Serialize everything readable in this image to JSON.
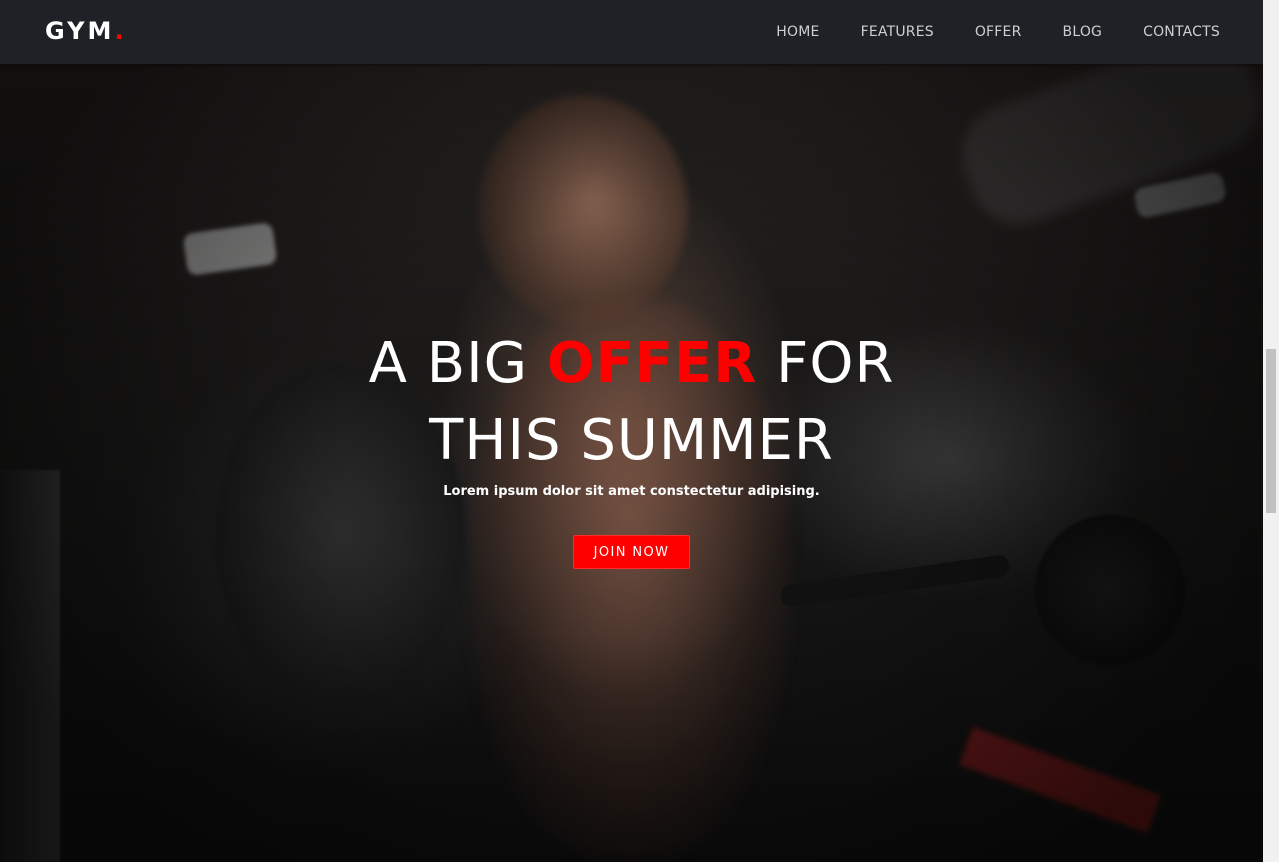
{
  "navbar": {
    "logo_text": "GYM",
    "logo_dot": ".",
    "links": [
      "HOME",
      "FEATURES",
      "OFFER",
      "BLOG",
      "CONTACTS"
    ]
  },
  "hero": {
    "headline_part1": "A BIG ",
    "headline_highlight": "OFFER",
    "headline_part2": " FOR",
    "headline_line2": "THIS SUMMER",
    "subtitle": "Lorem ipsum dolor sit amet constectetur adipising.",
    "cta_label": "JOIN NOW"
  },
  "colors": {
    "accent": "#ff0000",
    "navbar_bg": "#1e2125",
    "text": "#ffffff"
  }
}
